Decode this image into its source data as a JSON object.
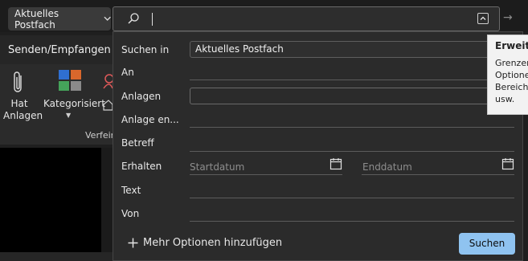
{
  "search": {
    "scope_label": "Aktuelles Postfach",
    "query": ""
  },
  "ribbon": {
    "tab": "Senden/Empfangen",
    "attach_label_line1": "Hat",
    "attach_label_line2": "Anlagen",
    "categorized_label": "Kategorisiert",
    "group_label": "Verfein"
  },
  "panel": {
    "rows": {
      "search_in": "Suchen in",
      "to": "An",
      "attachments": "Anlagen",
      "attachment_contains": "Anlage en...",
      "subject": "Betreff",
      "received": "Erhalten",
      "text": "Text",
      "from": "Von"
    },
    "search_in_value": "Aktuelles Postfach",
    "start_date_placeholder": "Startdatum",
    "end_date_placeholder": "Enddatum",
    "add_options_label": "Mehr Optionen hinzufügen",
    "search_button": "Suchen"
  },
  "tooltip": {
    "title": "Erweite",
    "lines": [
      "Grenzer",
      "Optione",
      "Bereich,",
      "usw."
    ]
  },
  "colors": {
    "accent_button": "#8fc3f0",
    "background": "#1f1f1f",
    "panel": "#2b2b2b"
  }
}
